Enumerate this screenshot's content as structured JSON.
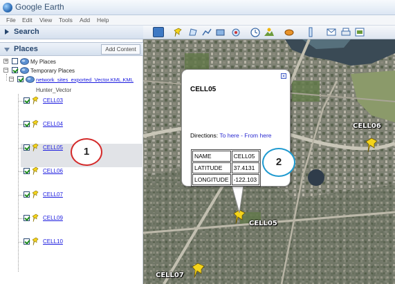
{
  "app": {
    "title": "Google Earth"
  },
  "menu": [
    "File",
    "Edit",
    "View",
    "Tools",
    "Add",
    "Help"
  ],
  "search_panel": {
    "label": "Search"
  },
  "places_panel": {
    "label": "Places",
    "add_content_label": "Add Content"
  },
  "tree": {
    "my_places": "My Places",
    "temporary_places": "Temporary Places",
    "kml_file": "network_sites_exported_Vector.KML.KML",
    "folder": "Hunter_Vector",
    "cells": [
      "CELL03",
      "CELL04",
      "CELL05",
      "CELL06",
      "CELL07",
      "CELL09",
      "CELL10"
    ],
    "selected": "CELL05"
  },
  "callouts": {
    "left": "1",
    "right": "2"
  },
  "balloon": {
    "title": "CELL05",
    "directions_prefix": "Directions:",
    "to_here": "To here",
    "separator": " - ",
    "from_here": "From here",
    "close_glyph": "x",
    "rows": [
      {
        "key": "NAME",
        "value": "CELL05"
      },
      {
        "key": "LATITUDE",
        "value": "37.4131"
      },
      {
        "key": "LONGITUDE",
        "value": "-122.103"
      }
    ]
  },
  "map_labels": {
    "cell06": "CELL06",
    "cell05": "CELL05",
    "cell07": "CELL07"
  },
  "colors": {
    "accent": "#27466e",
    "link": "#1a1adf",
    "callout_1": "#d42a2a",
    "callout_2": "#1f9ad0",
    "pin": "#f4d41c"
  },
  "toolbar_icons": [
    "sidebar-toggle-icon",
    "placemark-icon",
    "polygon-icon",
    "path-icon",
    "overlay-icon",
    "record-tour-icon",
    "historical-imagery-icon",
    "sunlight-icon",
    "planets-icon",
    "ruler-icon",
    "email-icon",
    "print-icon",
    "save-image-icon"
  ]
}
